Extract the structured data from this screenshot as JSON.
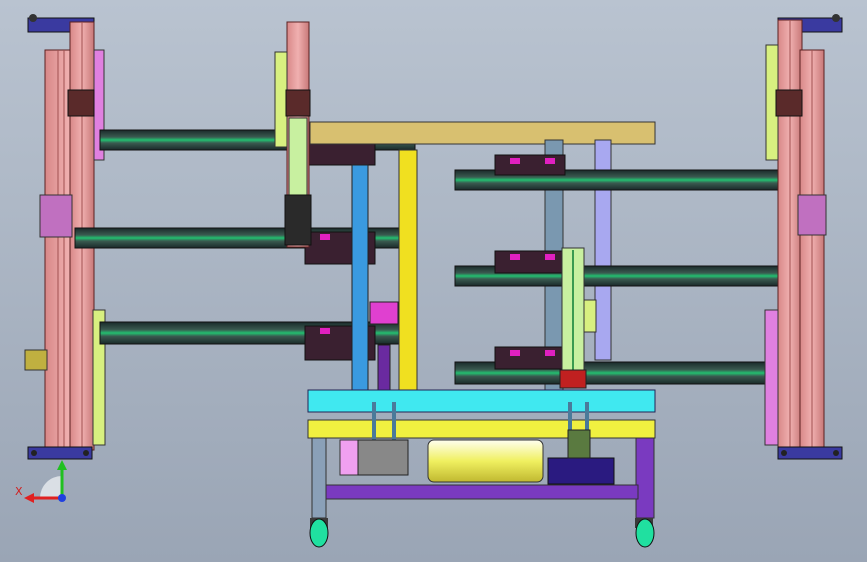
{
  "scene": {
    "background_top": "#b9c3d0",
    "background_bottom": "#9aa5b5"
  },
  "axis_triad": {
    "x_label": "X",
    "x_color": "#e02020",
    "y_color": "#20c020",
    "z_color": "#2040e0"
  },
  "palette": {
    "frame_pink": "#e8a0a0",
    "frame_dark": "#7a2a2a",
    "rail_dark": "#2a3a3a",
    "rail_green": "#1ea050",
    "carriage": "#3a2030",
    "magenta": "#e020c0",
    "yellow": "#f0e020",
    "blue": "#3a9ae0",
    "steel": "#7a98b0",
    "lavender": "#a8a8f0",
    "tan": "#d8c070",
    "cyan": "#40e8f0",
    "purple": "#7a3ac0",
    "caster": "#20e0a0",
    "base_navy": "#2a2090"
  }
}
